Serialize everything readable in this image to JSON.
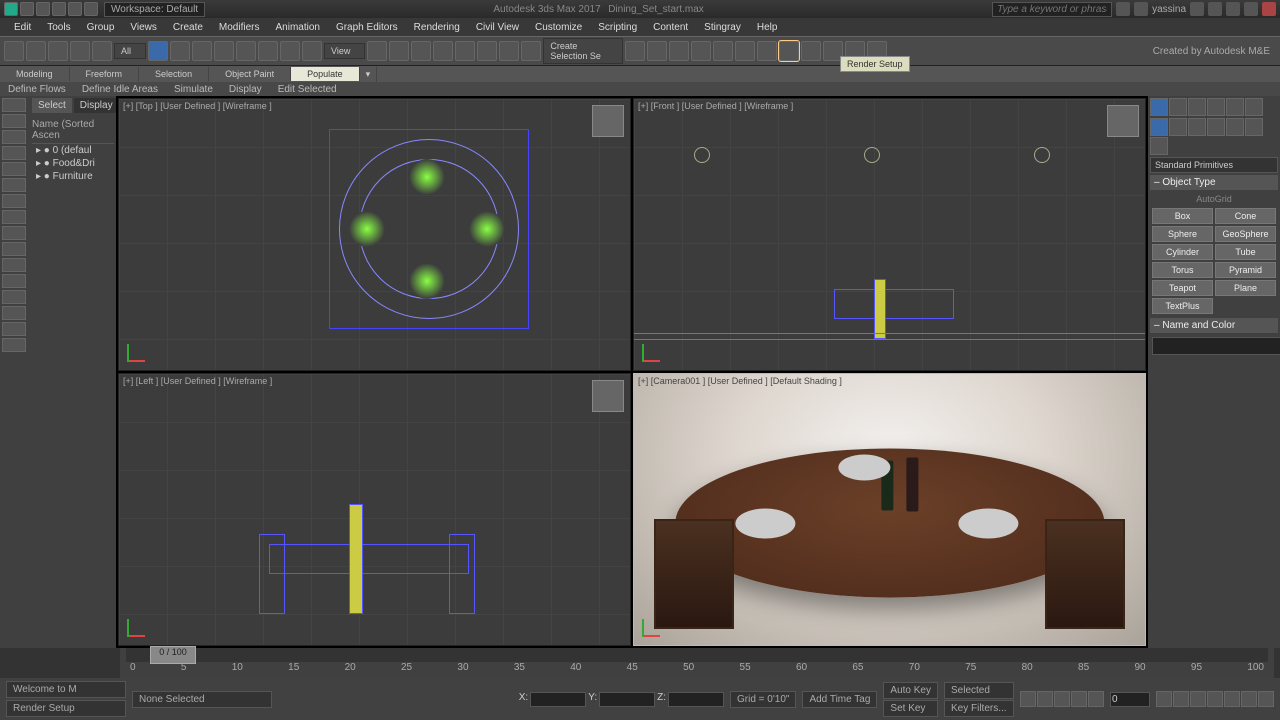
{
  "title": {
    "app": "Autodesk 3ds Max 2017",
    "file": "Dining_Set_start.max",
    "workspace": "Workspace: Default"
  },
  "search": {
    "ph": "Type a keyword or phrase"
  },
  "user": "yassina",
  "brand": "Created by Autodesk M&E",
  "menu": [
    "Edit",
    "Tools",
    "Group",
    "Views",
    "Create",
    "Modifiers",
    "Animation",
    "Graph Editors",
    "Rendering",
    "Civil View",
    "Customize",
    "Scripting",
    "Content",
    "Stingray",
    "Help"
  ],
  "toolbar_sel1": "All",
  "toolbar_sel2": "View",
  "toolbar_sel3": "Create Selection Se",
  "tooltip": "Render Setup",
  "ribbon": [
    "Modeling",
    "Freeform",
    "Selection",
    "Object Paint",
    "Populate"
  ],
  "ribbon_active": 4,
  "ribbon2": [
    "Define Flows",
    "Define Idle Areas",
    "Simulate",
    "Display",
    "Edit Selected"
  ],
  "explorer": {
    "tabs": [
      "Select",
      "Display"
    ],
    "title": "Name (Sorted Ascen",
    "items": [
      "0 (defaul",
      "Food&Dri",
      "Furniture"
    ]
  },
  "viewports": {
    "tl": "[+] [Top ] [User Defined ] [Wireframe ]",
    "tr": "[+] [Front ] [User Defined ] [Wireframe ]",
    "bl": "[+] [Left ] [User Defined ] [Wireframe ]",
    "br": "[+] [Camera001 ] [User Defined ] [Default Shading ]"
  },
  "right": {
    "drop": "Standard Primitives",
    "roll1": "Object Type",
    "autogrid": "AutoGrid",
    "prims": [
      "Box",
      "Cone",
      "Sphere",
      "GeoSphere",
      "Cylinder",
      "Tube",
      "Torus",
      "Pyramid",
      "Teapot",
      "Plane",
      "TextPlus"
    ],
    "roll2": "Name and Color"
  },
  "time": {
    "knob": "0 / 100",
    "ticks": [
      "0",
      "5",
      "10",
      "15",
      "20",
      "25",
      "30",
      "35",
      "40",
      "45",
      "50",
      "55",
      "60",
      "65",
      "70",
      "75",
      "80",
      "85",
      "90",
      "95",
      "100"
    ]
  },
  "status": {
    "welcome": "Welcome to M",
    "l2": "Render Setup",
    "sel": "None Selected",
    "x": "X:",
    "y": "Y:",
    "z": "Z:",
    "grid": "Grid = 0'10\"",
    "tag": "Add Time Tag",
    "autokey": "Auto Key",
    "setkey": "Set Key",
    "selected": "Selected",
    "keyfilters": "Key Filters...",
    "frame": "0"
  }
}
